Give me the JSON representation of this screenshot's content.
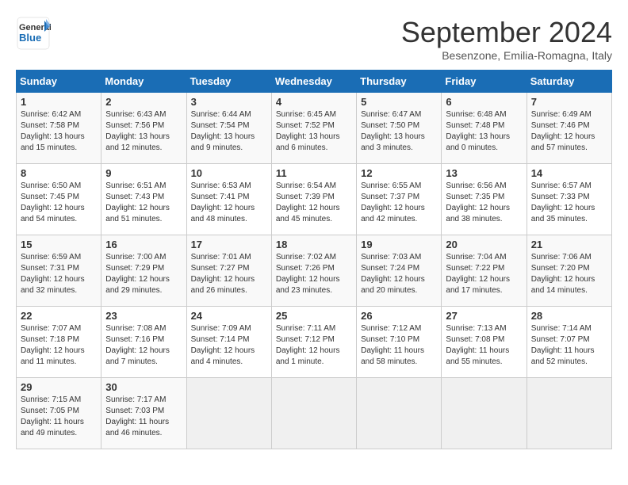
{
  "logo": {
    "line1": "General",
    "line2": "Blue"
  },
  "title": "September 2024",
  "subtitle": "Besenzone, Emilia-Romagna, Italy",
  "days_header": [
    "Sunday",
    "Monday",
    "Tuesday",
    "Wednesday",
    "Thursday",
    "Friday",
    "Saturday"
  ],
  "weeks": [
    [
      {
        "day": "1",
        "detail": "Sunrise: 6:42 AM\nSunset: 7:58 PM\nDaylight: 13 hours\nand 15 minutes."
      },
      {
        "day": "2",
        "detail": "Sunrise: 6:43 AM\nSunset: 7:56 PM\nDaylight: 13 hours\nand 12 minutes."
      },
      {
        "day": "3",
        "detail": "Sunrise: 6:44 AM\nSunset: 7:54 PM\nDaylight: 13 hours\nand 9 minutes."
      },
      {
        "day": "4",
        "detail": "Sunrise: 6:45 AM\nSunset: 7:52 PM\nDaylight: 13 hours\nand 6 minutes."
      },
      {
        "day": "5",
        "detail": "Sunrise: 6:47 AM\nSunset: 7:50 PM\nDaylight: 13 hours\nand 3 minutes."
      },
      {
        "day": "6",
        "detail": "Sunrise: 6:48 AM\nSunset: 7:48 PM\nDaylight: 13 hours\nand 0 minutes."
      },
      {
        "day": "7",
        "detail": "Sunrise: 6:49 AM\nSunset: 7:46 PM\nDaylight: 12 hours\nand 57 minutes."
      }
    ],
    [
      {
        "day": "8",
        "detail": "Sunrise: 6:50 AM\nSunset: 7:45 PM\nDaylight: 12 hours\nand 54 minutes."
      },
      {
        "day": "9",
        "detail": "Sunrise: 6:51 AM\nSunset: 7:43 PM\nDaylight: 12 hours\nand 51 minutes."
      },
      {
        "day": "10",
        "detail": "Sunrise: 6:53 AM\nSunset: 7:41 PM\nDaylight: 12 hours\nand 48 minutes."
      },
      {
        "day": "11",
        "detail": "Sunrise: 6:54 AM\nSunset: 7:39 PM\nDaylight: 12 hours\nand 45 minutes."
      },
      {
        "day": "12",
        "detail": "Sunrise: 6:55 AM\nSunset: 7:37 PM\nDaylight: 12 hours\nand 42 minutes."
      },
      {
        "day": "13",
        "detail": "Sunrise: 6:56 AM\nSunset: 7:35 PM\nDaylight: 12 hours\nand 38 minutes."
      },
      {
        "day": "14",
        "detail": "Sunrise: 6:57 AM\nSunset: 7:33 PM\nDaylight: 12 hours\nand 35 minutes."
      }
    ],
    [
      {
        "day": "15",
        "detail": "Sunrise: 6:59 AM\nSunset: 7:31 PM\nDaylight: 12 hours\nand 32 minutes."
      },
      {
        "day": "16",
        "detail": "Sunrise: 7:00 AM\nSunset: 7:29 PM\nDaylight: 12 hours\nand 29 minutes."
      },
      {
        "day": "17",
        "detail": "Sunrise: 7:01 AM\nSunset: 7:27 PM\nDaylight: 12 hours\nand 26 minutes."
      },
      {
        "day": "18",
        "detail": "Sunrise: 7:02 AM\nSunset: 7:26 PM\nDaylight: 12 hours\nand 23 minutes."
      },
      {
        "day": "19",
        "detail": "Sunrise: 7:03 AM\nSunset: 7:24 PM\nDaylight: 12 hours\nand 20 minutes."
      },
      {
        "day": "20",
        "detail": "Sunrise: 7:04 AM\nSunset: 7:22 PM\nDaylight: 12 hours\nand 17 minutes."
      },
      {
        "day": "21",
        "detail": "Sunrise: 7:06 AM\nSunset: 7:20 PM\nDaylight: 12 hours\nand 14 minutes."
      }
    ],
    [
      {
        "day": "22",
        "detail": "Sunrise: 7:07 AM\nSunset: 7:18 PM\nDaylight: 12 hours\nand 11 minutes."
      },
      {
        "day": "23",
        "detail": "Sunrise: 7:08 AM\nSunset: 7:16 PM\nDaylight: 12 hours\nand 7 minutes."
      },
      {
        "day": "24",
        "detail": "Sunrise: 7:09 AM\nSunset: 7:14 PM\nDaylight: 12 hours\nand 4 minutes."
      },
      {
        "day": "25",
        "detail": "Sunrise: 7:11 AM\nSunset: 7:12 PM\nDaylight: 12 hours\nand 1 minute."
      },
      {
        "day": "26",
        "detail": "Sunrise: 7:12 AM\nSunset: 7:10 PM\nDaylight: 11 hours\nand 58 minutes."
      },
      {
        "day": "27",
        "detail": "Sunrise: 7:13 AM\nSunset: 7:08 PM\nDaylight: 11 hours\nand 55 minutes."
      },
      {
        "day": "28",
        "detail": "Sunrise: 7:14 AM\nSunset: 7:07 PM\nDaylight: 11 hours\nand 52 minutes."
      }
    ],
    [
      {
        "day": "29",
        "detail": "Sunrise: 7:15 AM\nSunset: 7:05 PM\nDaylight: 11 hours\nand 49 minutes."
      },
      {
        "day": "30",
        "detail": "Sunrise: 7:17 AM\nSunset: 7:03 PM\nDaylight: 11 hours\nand 46 minutes."
      },
      {
        "day": "",
        "detail": ""
      },
      {
        "day": "",
        "detail": ""
      },
      {
        "day": "",
        "detail": ""
      },
      {
        "day": "",
        "detail": ""
      },
      {
        "day": "",
        "detail": ""
      }
    ]
  ]
}
